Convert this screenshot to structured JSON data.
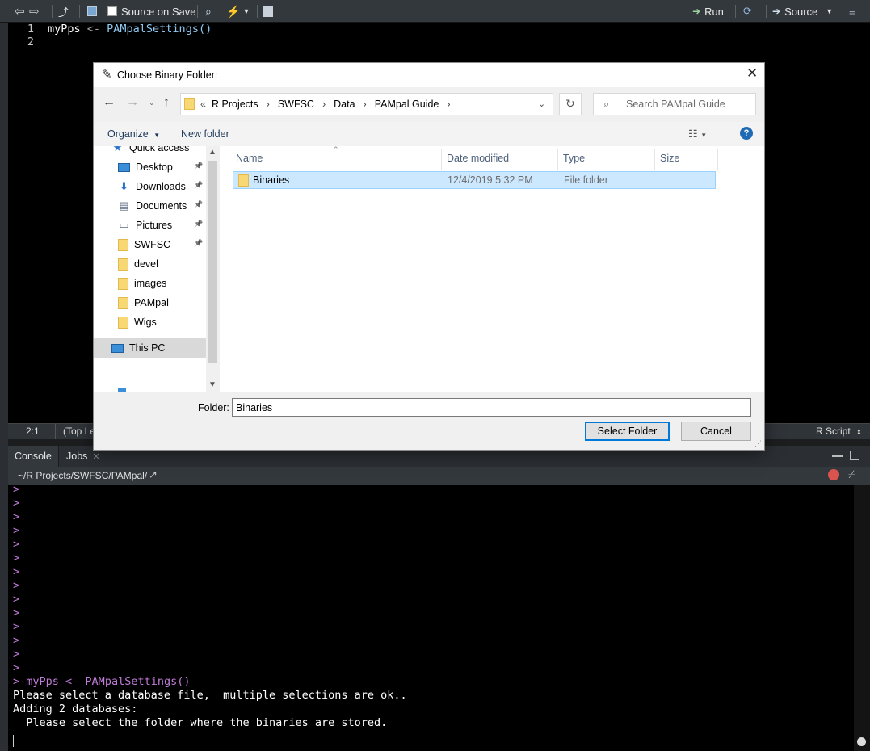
{
  "toolbar": {
    "source_on_save": "Source on Save",
    "run": "Run",
    "source": "Source"
  },
  "editor": {
    "lines": [
      {
        "num": "1",
        "var": "myPps",
        "op": " <- ",
        "call": "PAMpalSettings()"
      },
      {
        "num": "2",
        "var": "",
        "op": "",
        "call": ""
      }
    ],
    "status_position": "2:1",
    "status_scope": "(Top Le",
    "status_filetype": "R Script"
  },
  "console": {
    "tabs": [
      "Console",
      "Jobs"
    ],
    "path": "~/R Projects/SWFSC/PAMpal/",
    "empty_prompts": 14,
    "prompt": ">",
    "command": "myPps <- PAMpalSettings()",
    "output": [
      "Please select a database file,  multiple selections are ok..",
      "Adding 2 databases:",
      "  Please select the folder where the binaries are stored."
    ]
  },
  "dialog": {
    "title": "Choose Binary Folder:",
    "breadcrumb": [
      "R Projects",
      "SWFSC",
      "Data",
      "PAMpal Guide"
    ],
    "breadcrumb_overflow": "«",
    "search_placeholder": "Search PAMpal Guide",
    "organize": "Organize",
    "new_folder": "New folder",
    "nav_items": [
      {
        "label": "Quick access",
        "icon": "star-icon",
        "pinned": false,
        "indent": 0
      },
      {
        "label": "Desktop",
        "icon": "desktop-icon",
        "pinned": true,
        "indent": 1
      },
      {
        "label": "Downloads",
        "icon": "download-icon",
        "pinned": true,
        "indent": 1
      },
      {
        "label": "Documents",
        "icon": "documents-icon",
        "pinned": true,
        "indent": 1
      },
      {
        "label": "Pictures",
        "icon": "pictures-icon",
        "pinned": true,
        "indent": 1
      },
      {
        "label": "SWFSC",
        "icon": "folder-icon",
        "pinned": true,
        "indent": 1
      },
      {
        "label": "devel",
        "icon": "folder-icon",
        "pinned": false,
        "indent": 1
      },
      {
        "label": "images",
        "icon": "folder-icon",
        "pinned": false,
        "indent": 1
      },
      {
        "label": "PAMpal",
        "icon": "folder-icon",
        "pinned": false,
        "indent": 1
      },
      {
        "label": "Wigs",
        "icon": "folder-icon",
        "pinned": false,
        "indent": 1
      },
      {
        "label": "This PC",
        "icon": "pc-icon",
        "pinned": false,
        "indent": 0
      }
    ],
    "columns": [
      "Name",
      "Date modified",
      "Type",
      "Size"
    ],
    "files": [
      {
        "name": "Binaries",
        "date_modified": "12/4/2019 5:32 PM",
        "type": "File folder",
        "size": ""
      }
    ],
    "folder_label": "Folder:",
    "folder_value": "Binaries",
    "select_button": "Select Folder",
    "cancel_button": "Cancel"
  },
  "colors": {
    "r_function": "#8ec8f0",
    "console_prompt": "#c07bd8",
    "selection": "#cce8ff",
    "help_blue": "#1f6ab5"
  }
}
